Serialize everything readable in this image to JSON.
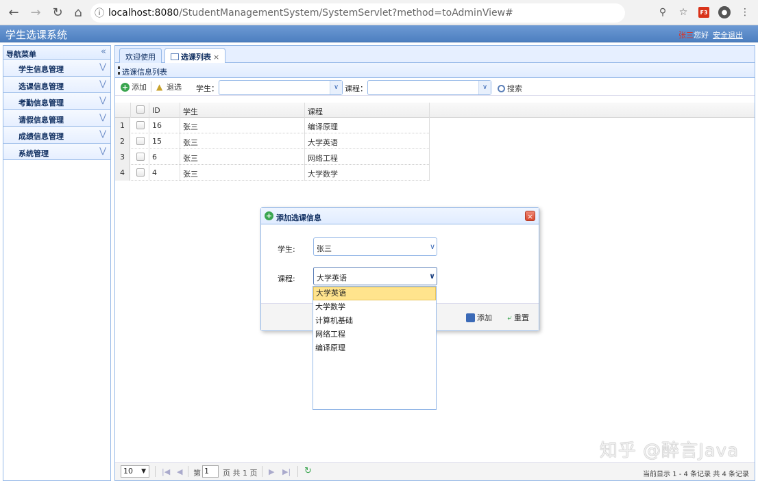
{
  "browser": {
    "url_host": "localhost:8080",
    "url_path": "/StudentManagementSystem/SystemServlet?method=toAdminView#",
    "ext_label": "F3"
  },
  "header": {
    "title": "学生选课系统",
    "user_name": "张三",
    "greeting": "您好",
    "logout": "安全退出"
  },
  "sidebar": {
    "title": "导航菜单",
    "items": [
      {
        "label": "学生信息管理"
      },
      {
        "label": "选课信息管理"
      },
      {
        "label": "考勤信息管理"
      },
      {
        "label": "请假信息管理"
      },
      {
        "label": "成绩信息管理"
      },
      {
        "label": "系统管理"
      }
    ]
  },
  "tabs": [
    {
      "label": "欢迎使用"
    },
    {
      "label": "选课列表"
    }
  ],
  "panel": {
    "title": "选课信息列表"
  },
  "toolbar": {
    "add": "添加",
    "withdraw": "退选",
    "student_label": "学生：",
    "course_label": "课程：",
    "search": "搜索"
  },
  "grid": {
    "headers": [
      "ID",
      "学生",
      "课程"
    ],
    "rows": [
      {
        "num": "1",
        "id": "16",
        "student": "张三",
        "course": "编译原理"
      },
      {
        "num": "2",
        "id": "15",
        "student": "张三",
        "course": "大学英语"
      },
      {
        "num": "3",
        "id": "6",
        "student": "张三",
        "course": "网络工程"
      },
      {
        "num": "4",
        "id": "4",
        "student": "张三",
        "course": "大学数学"
      }
    ]
  },
  "pager": {
    "page_size": "10",
    "page_prefix": "第",
    "page_value": "1",
    "page_suffix": "页 共 1 页",
    "info": "当前显示 1 - 4 条记录 共 4 条记录"
  },
  "dialog": {
    "title": "添加选课信息",
    "student_label": "学生:",
    "student_value": "张三",
    "course_label": "课程:",
    "course_value": "大学英语",
    "add_button": "添加",
    "reset_button": "重置",
    "options": [
      "大学英语",
      "大学数学",
      "计算机基础",
      "网络工程",
      "编译原理"
    ]
  },
  "watermark": "知乎 @醉言Java"
}
